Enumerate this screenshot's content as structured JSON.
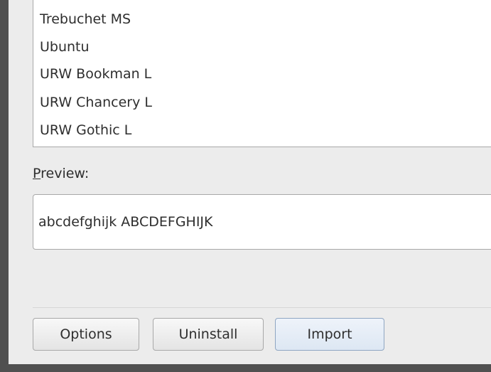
{
  "font_list": {
    "items": [
      "Trebuchet MS",
      "Ubuntu",
      "URW Bookman L",
      "URW Chancery L",
      "URW Gothic L"
    ]
  },
  "preview": {
    "label_mnemonic": "P",
    "label_rest": "review:",
    "sample_text": "abcdefghijk ABCDEFGHIJK"
  },
  "buttons": {
    "options": "Options",
    "uninstall": "Uninstall",
    "import": "Import"
  }
}
